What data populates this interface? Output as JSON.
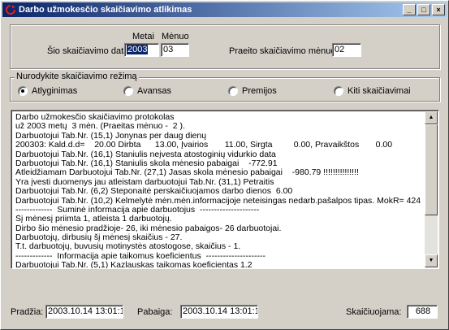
{
  "window": {
    "title": "Darbo užmokesčio skaičiavimo atlikimas",
    "buttons": {
      "minimize": "_",
      "maximize": "□",
      "close": "×"
    }
  },
  "period": {
    "year_header": "Metai",
    "month_header": "Mėnuo",
    "current_label": "Šio skaičiavimo data",
    "year_value": "2003",
    "month_value": "03",
    "previous_label": "Praeito skaičiavimo mėnuo:",
    "previous_value": "02"
  },
  "mode": {
    "title": "Nurodykite skaičiavimo režimą",
    "options": [
      {
        "label": "Atlyginimas",
        "selected": true
      },
      {
        "label": "Avansas",
        "selected": false
      },
      {
        "label": "Premijos",
        "selected": false
      },
      {
        "label": "Kiti skaičiavimai",
        "selected": false
      }
    ]
  },
  "log": {
    "lines": [
      "Darbo užmokesčio skaičiavimo protokolas",
      "už 2003 metų  3 mėn. (Praeitas mėnuo -  2 ).",
      "Darbuotojui Tab.Nr. (15,1) Jonynas per daug dienų",
      "200303: Kald.d.d=    20.00 Dirbta      13.00, Įvairios       11.00, Sirgta         0.00, Pravaikštos       0.00",
      "Darbuotojui Tab.Nr. (16,1) Staniulis neįvesta atostoginių vidurkio data",
      "Darbuotojui Tab.Nr. (16,1) Staniulis skola mėnesio pabaigai    -772.91",
      "Atleidžiamam Darbuotojui Tab.Nr. (27,1) Jasas skola mėnesio pabaigai    -980.79 !!!!!!!!!!!!!!!",
      "Yra įvesti duomenys jau atleistam darbuotojui Tab.Nr. (31,1) Petraitis",
      "Darbuotojui Tab.Nr. (6,2) Steponaitė perskaičiuojamos darbo dienos  6.00",
      "Darbuotojui Tab.Nr. (10,2) Kelmelytė mėn.mėn.informacijoje neteisingas nedarb.pašalpos tipas. MokR= 424",
      "-------------  Suminė informacija apie darbuotojus  ---------------------",
      "Šį mėnesį priimta 1, atleista 1 darbuotojų.",
      "Dirbo šio mėnesio pradžioje- 26, iki mėnesio pabaigos- 26 darbuotojai.",
      "Darbuotojų, dirbusių šį mėnesį skaičius - 27.",
      "T.t. darbuotojų, buvusių motinystės atostogose, skaičius - 1.",
      "-------------  Informacija apie taikomus koeficientus  ---------------------",
      "Darbuotojui Tab.Nr. (5,1) Kazlauskas taikomas koeficientas 1.2"
    ]
  },
  "footer": {
    "start_label": "Pradžia:",
    "start_value": "2003.10.14 13:01:14",
    "end_label": "Pabaiga:",
    "end_value": "2003.10.14 13:01:17",
    "count_label": "Skaičiuojama:",
    "count_value": "688"
  }
}
